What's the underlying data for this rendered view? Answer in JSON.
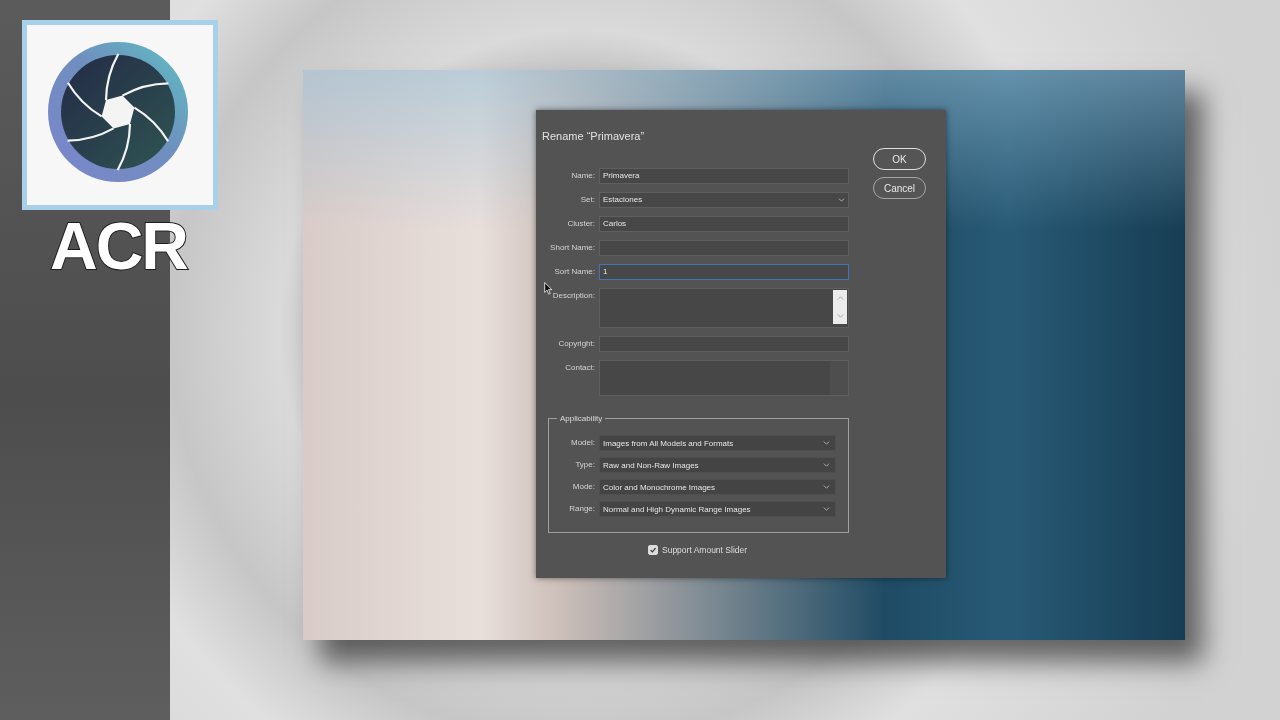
{
  "logo": {
    "text": "ACR"
  },
  "dialog": {
    "title": "Rename “Primavera”",
    "fields": [
      {
        "label": "Name:",
        "kind": "text",
        "value": "Primavera",
        "focused": false
      },
      {
        "label": "Set:",
        "kind": "dropdown",
        "value": "Estaciones",
        "focused": false
      },
      {
        "label": "Cluster:",
        "kind": "text",
        "value": "Carlos",
        "focused": false
      },
      {
        "label": "Short Name:",
        "kind": "text",
        "focused": false
      },
      {
        "label": "Sort Name:",
        "kind": "text",
        "value": "1",
        "focused": true
      },
      {
        "label": "Description:",
        "kind": "textarea",
        "scroll_arrows": true,
        "focused": false
      },
      {
        "label": "Copyright:",
        "kind": "text",
        "focused": false
      },
      {
        "label": "Contact:",
        "kind": "textarea",
        "scroll_arrows": false,
        "focused": false
      }
    ],
    "buttons": [
      {
        "label": "OK",
        "default": true
      },
      {
        "label": "Cancel",
        "default": false
      }
    ],
    "applicability": {
      "title": "Applicability",
      "selects": [
        {
          "label": "Model:",
          "value": "Images from All Models and Formats"
        },
        {
          "label": "Type:",
          "value": "Raw and Non-Raw Images"
        },
        {
          "label": "Mode:",
          "value": "Color and Monochrome Images"
        },
        {
          "label": "Range:",
          "value": "Normal and High Dynamic Range Images"
        }
      ]
    },
    "checkbox": {
      "label": "Support Amount Slider",
      "checked": true
    }
  }
}
